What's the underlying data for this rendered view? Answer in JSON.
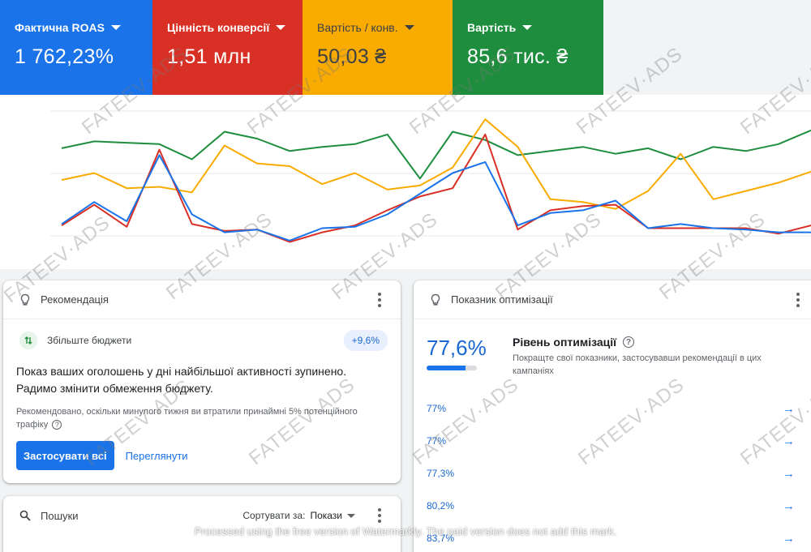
{
  "kpis": [
    {
      "label": "Фактична ROAS",
      "value": "1 762,23%",
      "color": "#1a73e8"
    },
    {
      "label": "Цінність конверсії",
      "value": "1,51 млн",
      "color": "#d93025"
    },
    {
      "label": "Вартість / конв.",
      "value": "50,03 ₴",
      "color": "#f9ab00"
    },
    {
      "label": "Вартість",
      "value": "85,6 тис. ₴",
      "color": "#1e8e3e"
    }
  ],
  "chart_data": {
    "type": "line",
    "series": [
      {
        "color": "#1e8e3e",
        "values": [
          63,
          68,
          67,
          66,
          55,
          75,
          70,
          61,
          64,
          66,
          73,
          41,
          75,
          69,
          58,
          61,
          64,
          59,
          63,
          55,
          64,
          61,
          66,
          76
        ]
      },
      {
        "color": "#f9ab00",
        "values": [
          40,
          45,
          34,
          35,
          31,
          65,
          52,
          50,
          37,
          45,
          33,
          36,
          49,
          84,
          64,
          26,
          24,
          19,
          32,
          59,
          26,
          32,
          38,
          46
        ]
      },
      {
        "color": "#d93025",
        "values": [
          7,
          22,
          6,
          62,
          8,
          3,
          4,
          -5,
          2,
          7,
          18,
          28,
          34,
          73,
          4,
          18,
          21,
          22,
          5,
          5,
          5,
          5,
          1,
          7
        ]
      },
      {
        "color": "#1a73e8",
        "values": [
          8,
          24,
          10,
          58,
          15,
          2,
          4,
          -4,
          5,
          6,
          15,
          30,
          45,
          53,
          7,
          16,
          18,
          25,
          5,
          8,
          5,
          4,
          2,
          2
        ]
      }
    ]
  },
  "recommendation": {
    "header": "Рекомендація",
    "item_name": "Збільште бюджети",
    "chip": "+9,6%",
    "main_text": "Показ ваших оголошень у дні найбільшої активності зупинено. Радимо змінити обмеження бюджету.",
    "note": "Рекомендовано, оскільки минулого тижня ви втратили принаймні 5% потенційного трафіку",
    "apply_all": "Застосувати всі",
    "view": "Переглянути"
  },
  "search": {
    "header": "Пошуки",
    "sort_label": "Сортувати за:",
    "sort_value": "Покази"
  },
  "optimization": {
    "header": "Показник оптимізації",
    "score": "77,6%",
    "score_fraction": 0.776,
    "title": "Рівень оптимізації",
    "description": "Покращте свої показники, застосувавши рекомендації в цих кампаніях",
    "rows": [
      "77%",
      "77%",
      "77,3%",
      "80,2%",
      "83,7%"
    ]
  },
  "watermark": {
    "text": "FATEEV·ADS",
    "note": "Processed using the free version of Watermarkly. The paid version does not add this mark."
  }
}
